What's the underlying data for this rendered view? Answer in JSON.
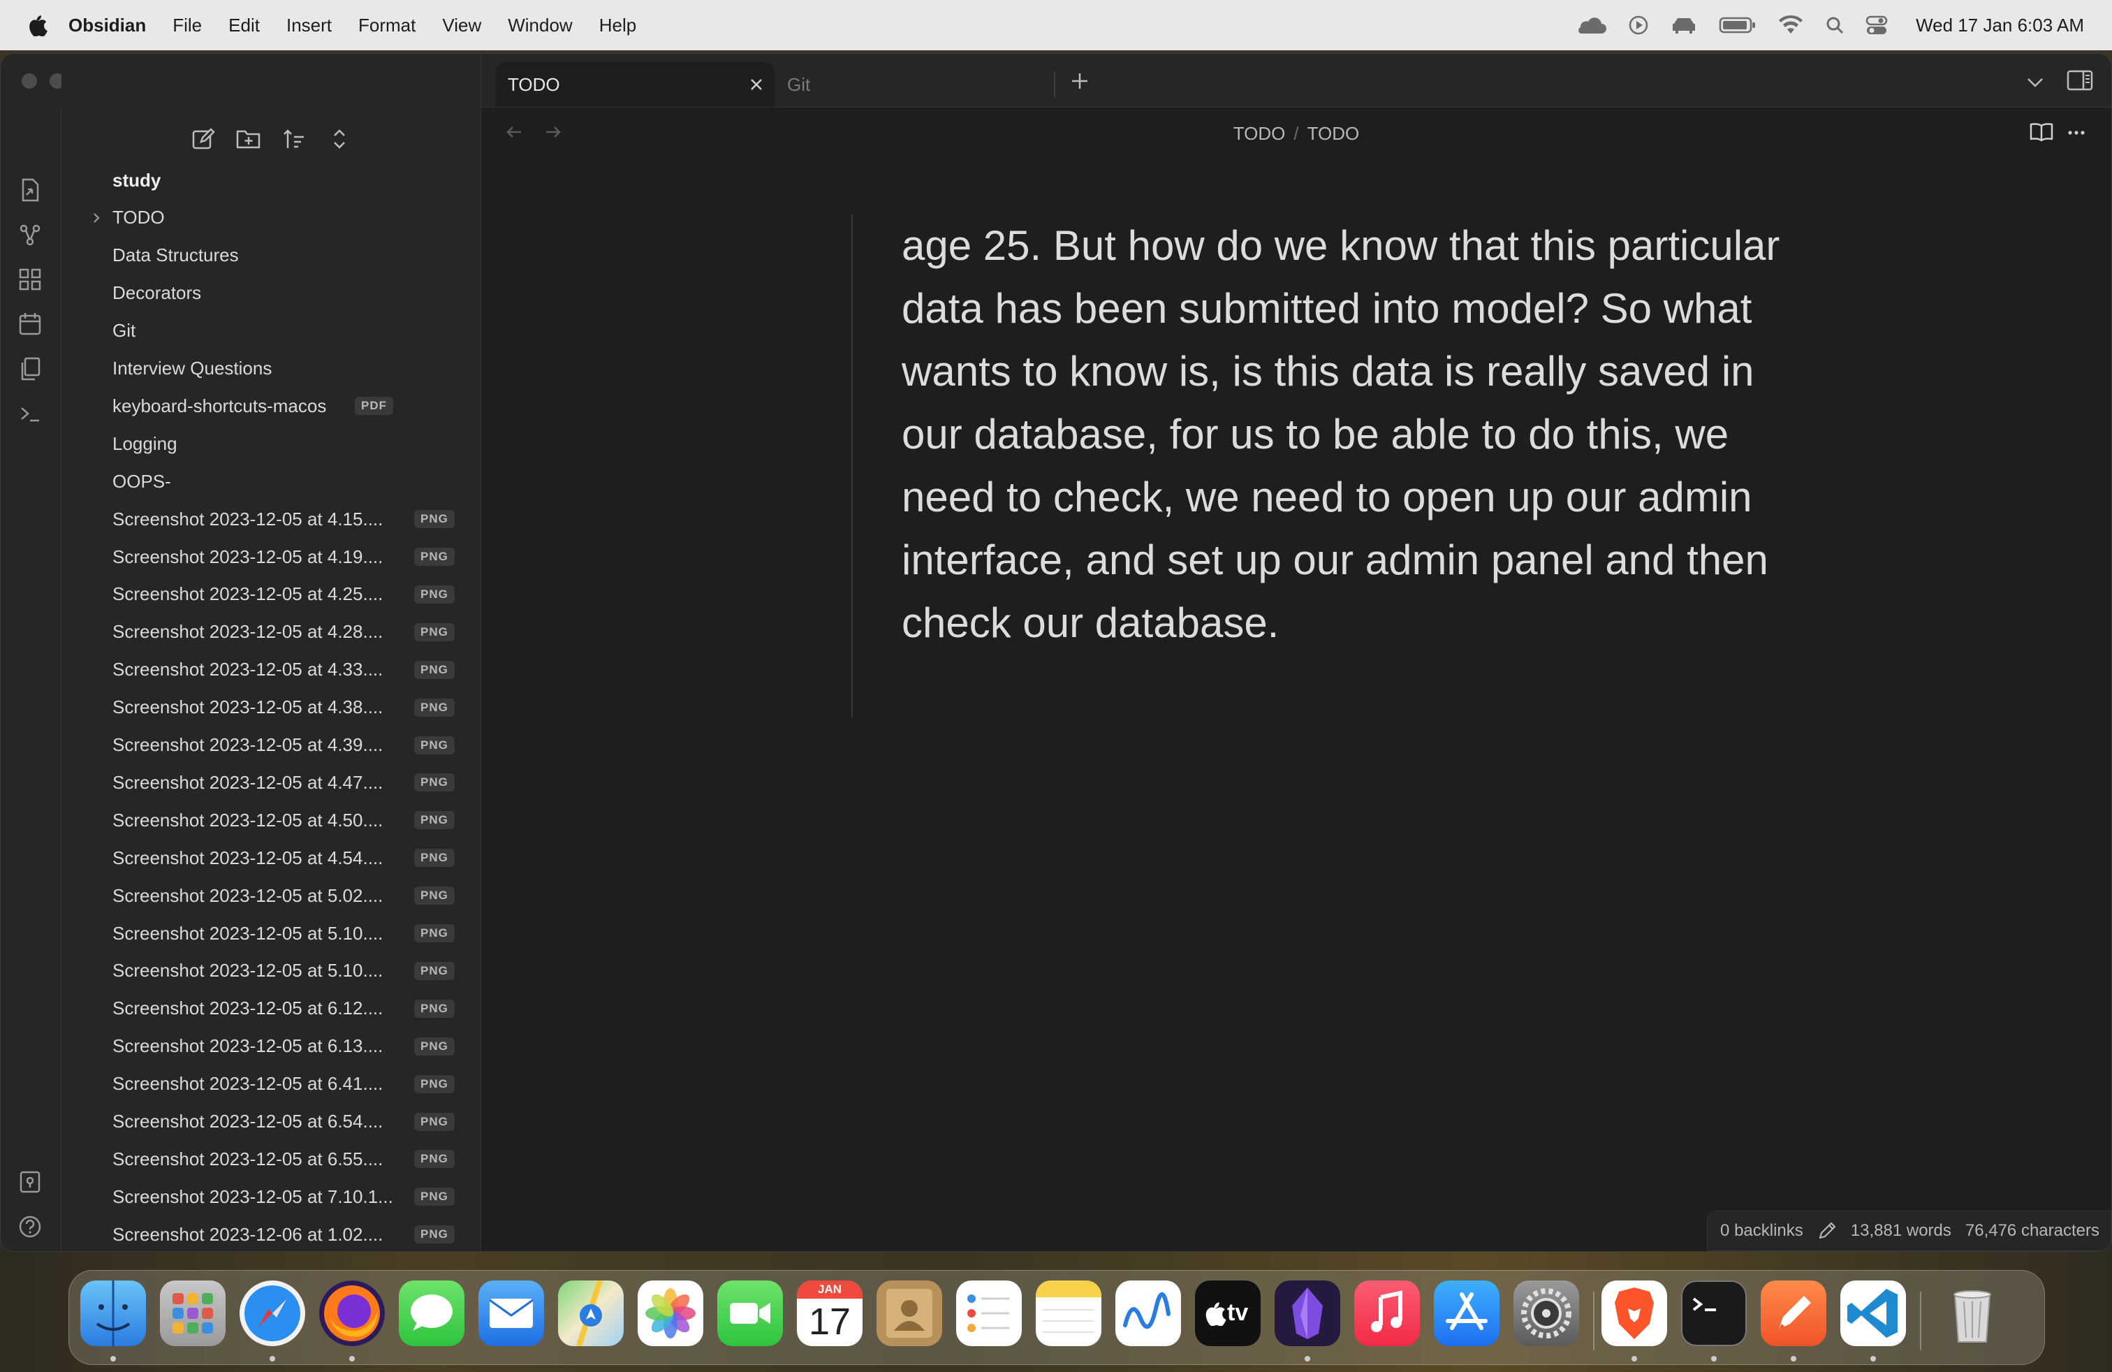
{
  "menubar": {
    "app_name": "Obsidian",
    "items": [
      "File",
      "Edit",
      "Insert",
      "Format",
      "View",
      "Window",
      "Help"
    ],
    "clock": "Wed 17 Jan  6:03 AM"
  },
  "tabs": [
    {
      "label": "TODO",
      "active": true
    },
    {
      "label": "Git",
      "active": false
    }
  ],
  "breadcrumb": {
    "parent": "TODO",
    "separator": "/",
    "current": "TODO"
  },
  "file_tree": {
    "vault": "study",
    "items": [
      {
        "name": "TODO",
        "type": "folder",
        "badge": ""
      },
      {
        "name": "Data Structures",
        "type": "file",
        "badge": ""
      },
      {
        "name": "Decorators",
        "type": "file",
        "badge": ""
      },
      {
        "name": "Git",
        "type": "file",
        "badge": ""
      },
      {
        "name": "Interview Questions",
        "type": "file",
        "badge": ""
      },
      {
        "name": "keyboard-shortcuts-macos",
        "type": "file",
        "badge": "PDF"
      },
      {
        "name": "Logging",
        "type": "file",
        "badge": ""
      },
      {
        "name": "OOPS-",
        "type": "file",
        "badge": ""
      },
      {
        "name": "Screenshot 2023-12-05 at 4.15....",
        "type": "file",
        "badge": "PNG"
      },
      {
        "name": "Screenshot 2023-12-05 at 4.19....",
        "type": "file",
        "badge": "PNG"
      },
      {
        "name": "Screenshot 2023-12-05 at 4.25....",
        "type": "file",
        "badge": "PNG"
      },
      {
        "name": "Screenshot 2023-12-05 at 4.28....",
        "type": "file",
        "badge": "PNG"
      },
      {
        "name": "Screenshot 2023-12-05 at 4.33....",
        "type": "file",
        "badge": "PNG"
      },
      {
        "name": "Screenshot 2023-12-05 at 4.38....",
        "type": "file",
        "badge": "PNG"
      },
      {
        "name": "Screenshot 2023-12-05 at 4.39....",
        "type": "file",
        "badge": "PNG"
      },
      {
        "name": "Screenshot 2023-12-05 at 4.47....",
        "type": "file",
        "badge": "PNG"
      },
      {
        "name": "Screenshot 2023-12-05 at 4.50....",
        "type": "file",
        "badge": "PNG"
      },
      {
        "name": "Screenshot 2023-12-05 at 4.54....",
        "type": "file",
        "badge": "PNG"
      },
      {
        "name": "Screenshot 2023-12-05 at 5.02....",
        "type": "file",
        "badge": "PNG"
      },
      {
        "name": "Screenshot 2023-12-05 at 5.10....",
        "type": "file",
        "badge": "PNG"
      },
      {
        "name": "Screenshot 2023-12-05 at 5.10....",
        "type": "file",
        "badge": "PNG"
      },
      {
        "name": "Screenshot 2023-12-05 at 6.12....",
        "type": "file",
        "badge": "PNG"
      },
      {
        "name": "Screenshot 2023-12-05 at 6.13....",
        "type": "file",
        "badge": "PNG"
      },
      {
        "name": "Screenshot 2023-12-05 at 6.41....",
        "type": "file",
        "badge": "PNG"
      },
      {
        "name": "Screenshot 2023-12-05 at 6.54....",
        "type": "file",
        "badge": "PNG"
      },
      {
        "name": "Screenshot 2023-12-05 at 6.55....",
        "type": "file",
        "badge": "PNG"
      },
      {
        "name": "Screenshot 2023-12-05 at 7.10.1...",
        "type": "file",
        "badge": "PNG"
      },
      {
        "name": "Screenshot 2023-12-06 at 1.02....",
        "type": "file",
        "badge": "PNG"
      }
    ]
  },
  "editor": {
    "text": "age 25. But how do we know that this particular data has been submitted into model? So what wants to know is, is this data is really saved in our database, for us to be able to do this, we need to check, we need to open up our admin interface, and set up our admin panel and then check our database."
  },
  "statusbar": {
    "backlinks": "0 backlinks",
    "words": "13,881 words",
    "characters": "76,476 characters"
  },
  "calendar_icon": {
    "month": "JAN",
    "day": "17"
  },
  "appletv_label": "tv",
  "dock": {
    "apps": [
      "finder",
      "launchpad",
      "safari",
      "firefox",
      "messages",
      "mail",
      "maps",
      "photos",
      "facetime",
      "calendar",
      "contacts",
      "reminders",
      "notes",
      "freeform",
      "tv",
      "obsidian",
      "music",
      "app-store",
      "system-settings",
      "brave",
      "terminal",
      "pen-app",
      "vscode",
      "trash"
    ]
  }
}
